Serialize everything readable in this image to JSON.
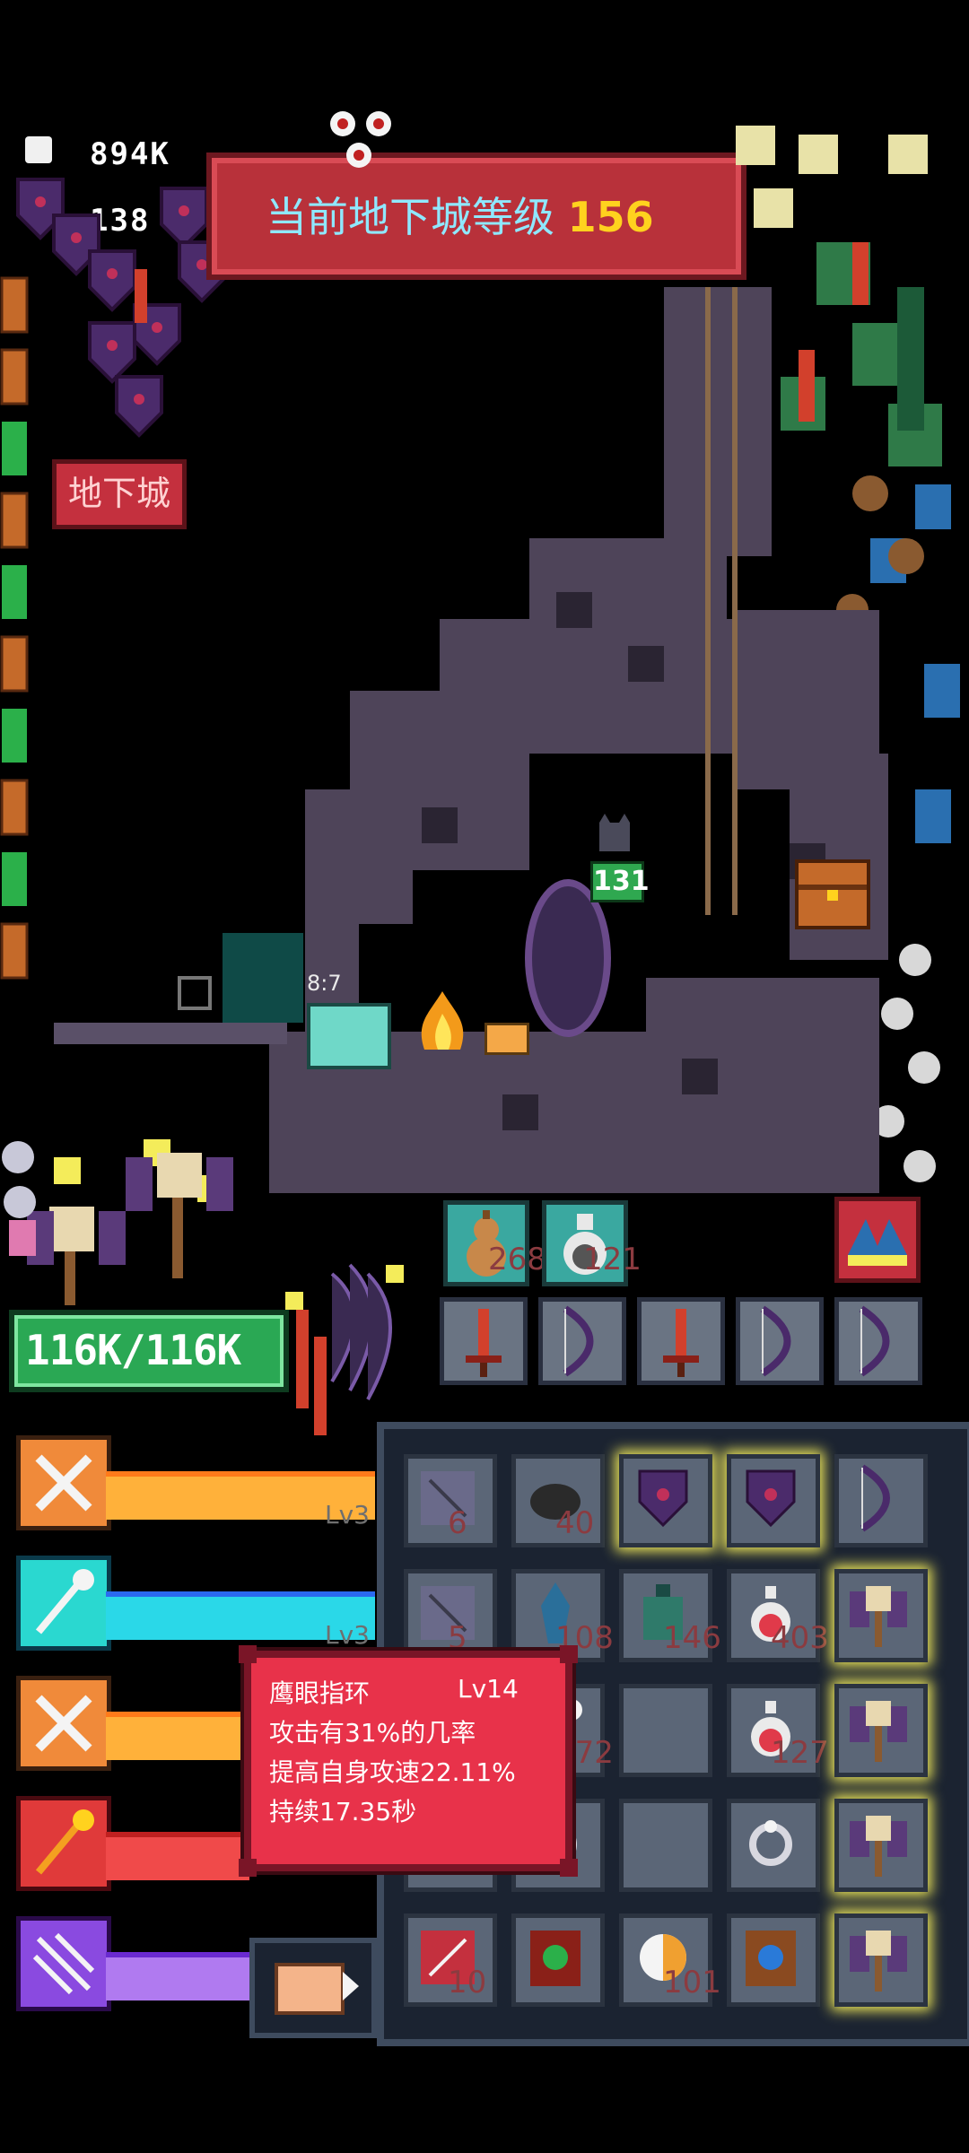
{
  "hud": {
    "gold": "894K",
    "gems": "138"
  },
  "banner": {
    "label": "当前地下城等级",
    "level": "156"
  },
  "buttons": {
    "dungeon": "地下城"
  },
  "scene": {
    "chest_timer": "8:7",
    "enemy_hp": "131"
  },
  "player": {
    "hp": "116K/116K"
  },
  "quickbar": {
    "consumables": [
      {
        "icon": "gourd-icon",
        "count": "268"
      },
      {
        "icon": "potion-bottle-icon",
        "count": "121"
      }
    ],
    "weapons": [
      "red-sword-icon",
      "bow-icon",
      "red-sword-icon",
      "bow-icon",
      "bow-icon"
    ]
  },
  "skills": [
    {
      "icon": "crossed-swords-icon",
      "level": "Lv3"
    },
    {
      "icon": "magic-staff-icon",
      "level": "Lv3"
    },
    {
      "icon": "crossed-swords-icon",
      "level": ""
    },
    {
      "icon": "fire-staff-icon",
      "level": ""
    },
    {
      "icon": "arrows-icon",
      "level": ""
    }
  ],
  "inventory": {
    "rows": [
      [
        {
          "icon": "scroll-icon",
          "count": "6"
        },
        {
          "icon": "stone-icon",
          "count": "40"
        },
        {
          "icon": "shield-icon",
          "count": ""
        },
        {
          "icon": "shield-icon",
          "count": ""
        },
        {
          "icon": "bow-icon",
          "count": ""
        }
      ],
      [
        {
          "icon": "scroll-icon",
          "count": "5"
        },
        {
          "icon": "crystal-icon",
          "count": "108"
        },
        {
          "icon": "potion-jar-icon",
          "count": "146"
        },
        {
          "icon": "red-potion-icon",
          "count": "403"
        },
        {
          "icon": "skull-axe-icon",
          "count": ""
        }
      ],
      [
        {
          "icon": "green-bag-icon",
          "count": ""
        },
        {
          "icon": "eye-staff-icon",
          "count": "172"
        },
        {
          "icon": "blank",
          "count": ""
        },
        {
          "icon": "red-potion-icon",
          "count": "127"
        },
        {
          "icon": "skull-axe-icon",
          "count": ""
        }
      ],
      [
        {
          "icon": "ring-icon",
          "count": ""
        },
        {
          "icon": "ring-icon",
          "count": ""
        },
        {
          "icon": "blank",
          "count": ""
        },
        {
          "icon": "ring-icon",
          "count": ""
        },
        {
          "icon": "skull-axe-icon",
          "count": ""
        }
      ],
      [
        {
          "icon": "red-scroll-icon",
          "count": "10"
        },
        {
          "icon": "emerald-book-icon",
          "count": ""
        },
        {
          "icon": "orb-icon",
          "count": "101"
        },
        {
          "icon": "sapphire-book-icon",
          "count": ""
        },
        {
          "icon": "skull-axe-icon",
          "count": ""
        }
      ]
    ]
  },
  "tooltip": {
    "name": "鹰眼指环",
    "level": "Lv14",
    "line1": "攻击有31%的几率",
    "line2": "提高自身攻速22.11%",
    "line3": "持续17.35秒"
  },
  "colors": {
    "background": "#000000",
    "banner": "#b8313a",
    "hp": "#2aa854",
    "tooltip": "#e8324a",
    "inventory": "#1b2331"
  }
}
